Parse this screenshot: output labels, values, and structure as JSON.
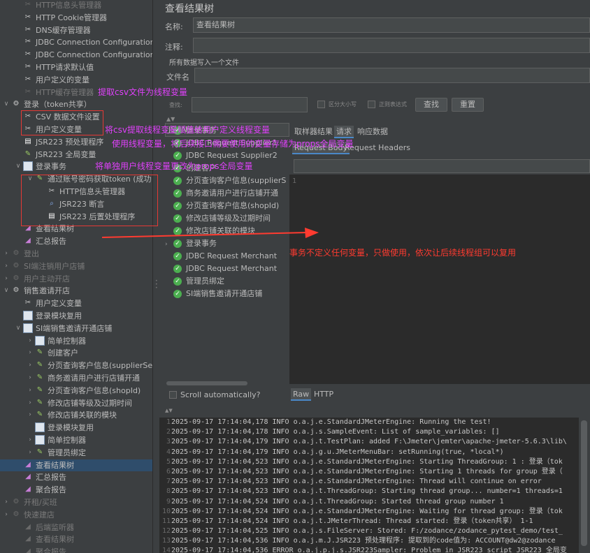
{
  "tree": {
    "items": [
      {
        "label": "HTTP信息头管理器",
        "icon": "wrench-icon",
        "level": 1,
        "dim": true
      },
      {
        "label": "HTTP Cookie管理器",
        "icon": "wrench-icon",
        "level": 1
      },
      {
        "label": "DNS缓存管理器",
        "icon": "wrench-icon",
        "level": 1
      },
      {
        "label": "JDBC Connection Configuration",
        "icon": "wrench-icon",
        "level": 1
      },
      {
        "label": "JDBC Connection Configuration",
        "icon": "wrench-icon",
        "level": 1
      },
      {
        "label": "HTTP请求默认值",
        "icon": "wrench-icon",
        "level": 1
      },
      {
        "label": "用户定义的变量",
        "icon": "wrench-icon",
        "level": 1
      },
      {
        "label": "HTTP缓存管理器",
        "icon": "wrench-icon",
        "level": 1,
        "dim": true
      },
      {
        "label": "登录（token共享）",
        "icon": "gear-icon",
        "level": 0,
        "arrow": "down"
      },
      {
        "label": "CSV 数据文件设置",
        "icon": "wrench-icon",
        "level": 1
      },
      {
        "label": "用户定义变量",
        "icon": "wrench-icon",
        "level": 1
      },
      {
        "label": "JSR223 预处理程序",
        "icon": "script-icon",
        "level": 1
      },
      {
        "label": "JSR223 全局变量",
        "icon": "pencil-icon",
        "level": 1
      },
      {
        "label": "登录事务",
        "icon": "controller-icon",
        "level": 1,
        "arrow": "down"
      },
      {
        "label": "通过账号密码获取token (成功",
        "icon": "pencil-icon",
        "level": 2,
        "arrow": "down"
      },
      {
        "label": "HTTP信息头管理器",
        "icon": "wrench-icon",
        "level": 3
      },
      {
        "label": "JSR223 断言",
        "icon": "magnifier-icon",
        "level": 3
      },
      {
        "label": "JSR223 后置处理程序",
        "icon": "script-icon",
        "level": 3
      },
      {
        "label": "查看结果树",
        "icon": "chart-icon",
        "level": 1
      },
      {
        "label": "汇总报告",
        "icon": "chart-icon",
        "level": 1
      },
      {
        "label": "登出",
        "icon": "gear-icon",
        "level": 0,
        "arrow": "right",
        "dim": true
      },
      {
        "label": "SI端注销用户店铺",
        "icon": "gear-icon",
        "level": 0,
        "arrow": "right",
        "dim": true
      },
      {
        "label": "用户主动开店",
        "icon": "gear-icon",
        "level": 0,
        "arrow": "right",
        "dim": true
      },
      {
        "label": "销售邀请开店",
        "icon": "gear-icon",
        "level": 0,
        "arrow": "down"
      },
      {
        "label": "用户定义变量",
        "icon": "wrench-icon",
        "level": 1
      },
      {
        "label": "登录模块复用",
        "icon": "controller-icon",
        "level": 1
      },
      {
        "label": "SI端销售邀请开通店铺",
        "icon": "controller-icon",
        "level": 1,
        "arrow": "down"
      },
      {
        "label": "简单控制器",
        "icon": "controller-icon",
        "level": 2,
        "arrow": "right"
      },
      {
        "label": "创建客户",
        "icon": "pencil-icon",
        "level": 2,
        "arrow": "right"
      },
      {
        "label": "分页查询客户信息(supplierSe",
        "icon": "pencil-icon",
        "level": 2,
        "arrow": "right"
      },
      {
        "label": "商务邀请用户进行店铺开通",
        "icon": "pencil-icon",
        "level": 2,
        "arrow": "right"
      },
      {
        "label": "分页查询客户信息(shopId)",
        "icon": "pencil-icon",
        "level": 2,
        "arrow": "right"
      },
      {
        "label": "修改店铺等级及过期时间",
        "icon": "pencil-icon",
        "level": 2,
        "arrow": "right"
      },
      {
        "label": "修改店铺关联的模块",
        "icon": "pencil-icon",
        "level": 2,
        "arrow": "right"
      },
      {
        "label": "登录模块复用",
        "icon": "controller-icon",
        "level": 2
      },
      {
        "label": "简单控制器",
        "icon": "controller-icon",
        "level": 2,
        "arrow": "right"
      },
      {
        "label": "管理员绑定",
        "icon": "pencil-icon",
        "level": 2,
        "arrow": "right"
      },
      {
        "label": "查看结果树",
        "icon": "chart-icon",
        "level": 1,
        "selected": true
      },
      {
        "label": "汇总报告",
        "icon": "chart-icon",
        "level": 1
      },
      {
        "label": "聚合报告",
        "icon": "chart-icon",
        "level": 1
      },
      {
        "label": "开租/买班",
        "icon": "gear-icon",
        "level": 0,
        "arrow": "right",
        "dim": true
      },
      {
        "label": "快速建店",
        "icon": "gear-icon",
        "level": 0,
        "arrow": "right",
        "dim": true
      },
      {
        "label": "后端监听器",
        "icon": "chart-icon",
        "level": 1,
        "dim": true
      },
      {
        "label": "查看结果树",
        "icon": "chart-icon",
        "level": 1,
        "dim": true
      },
      {
        "label": "聚合报告",
        "icon": "chart-icon",
        "level": 1,
        "dim": true
      }
    ]
  },
  "panel": {
    "title": "查看结果树",
    "name_label": "名称:",
    "name_value": "查看结果树",
    "comment_label": "注释:",
    "write_all_label": "所有数据写入一个文件",
    "filename_label": "文件名",
    "search_label": "查找:",
    "case_sensitive_label": "区分大小写",
    "regex_label": "正则表达式",
    "search_button": "查找",
    "reset_button": "重置",
    "renderer_label": "JSON",
    "tabs": [
      "取样器结果",
      "请求",
      "响应数据"
    ],
    "subtabs": [
      "Request Body",
      "Request Headers"
    ],
    "line_number": "1",
    "scroll_auto_label": "Scroll automatically?",
    "bottom_tabs": [
      "Raw",
      "HTTP"
    ]
  },
  "results": [
    {
      "label": "登录事务",
      "expand": true
    },
    {
      "label": "JDBC Request Supplier1"
    },
    {
      "label": "JDBC Request Supplier2"
    },
    {
      "label": "创建客户"
    },
    {
      "label": "分页查询客户信息(supplierS"
    },
    {
      "label": "商务邀请用户进行店铺开通"
    },
    {
      "label": "分页查询客户信息(shopId)"
    },
    {
      "label": "修改店铺等级及过期时间"
    },
    {
      "label": "修改店铺关联的模块"
    },
    {
      "label": "登录事务",
      "expand": true
    },
    {
      "label": "JDBC Request Merchant"
    },
    {
      "label": "JDBC Request Merchant"
    },
    {
      "label": "管理员绑定"
    },
    {
      "label": "SI端销售邀请开通店铺"
    }
  ],
  "log": [
    "2025-09-17 17:14:04,178 INFO o.a.j.e.StandardJMeterEngine: Running the test!",
    "2025-09-17 17:14:04,178 INFO o.a.j.s.SampleEvent: List of sample_variables: []",
    "2025-09-17 17:14:04,179 INFO o.a.j.t.TestPlan: added F:\\Jmeter\\jemter\\apache-jmeter-5.6.3\\lib\\",
    "2025-09-17 17:14:04,179 INFO o.a.j.g.u.JMeterMenuBar: setRunning(true, *local*)",
    "2025-09-17 17:14:04,523 INFO o.a.j.e.StandardJMeterEngine: Starting ThreadGroup: 1 : 登录（tok",
    "2025-09-17 17:14:04,523 INFO o.a.j.e.StandardJMeterEngine: Starting 1 threads for group 登录（",
    "2025-09-17 17:14:04,523 INFO o.a.j.e.StandardJMeterEngine: Thread will continue on error",
    "2025-09-17 17:14:04,523 INFO o.a.j.t.ThreadGroup: Starting thread group... number=1 threads=1",
    "2025-09-17 17:14:04,524 INFO o.a.j.t.ThreadGroup: Started thread group number 1",
    "2025-09-17 17:14:04,524 INFO o.a.j.e.StandardJMeterEngine: Waiting for thread group: 登录（tok",
    "2025-09-17 17:14:04,524 INFO o.a.j.t.JMeterThread: Thread started: 登录（token共享） 1-1",
    "2025-09-17 17:14:04,525 INFO o.a.j.s.FileServer: Stored: F:/zodance/zodance_pytest_demo/test_",
    "2025-09-17 17:14:04,536 INFO o.a.j.m.J.JSR223 预处理程序: 提取到的code值为: ACCOUNT@dw2@zodance",
    "2025-09-17 17:14:04,536 ERROR o.a.j.p.j.s.JSR223Sampler: Problem in JSR223 script JSR223 全局变"
  ],
  "annotations": {
    "csv_note": "提取csv文件为线程变量",
    "assign_note": "将csv提取线程变量赋值给用户定义线程变量",
    "use_note": "使用线程变量，将后续接口需要使用的变量存储为props全局变量",
    "single_note": "将单独用户线程变量更改为props全局变量",
    "tx_note": "事务不定义任何变量，只做使用，依次让后续线程组可以复用"
  }
}
